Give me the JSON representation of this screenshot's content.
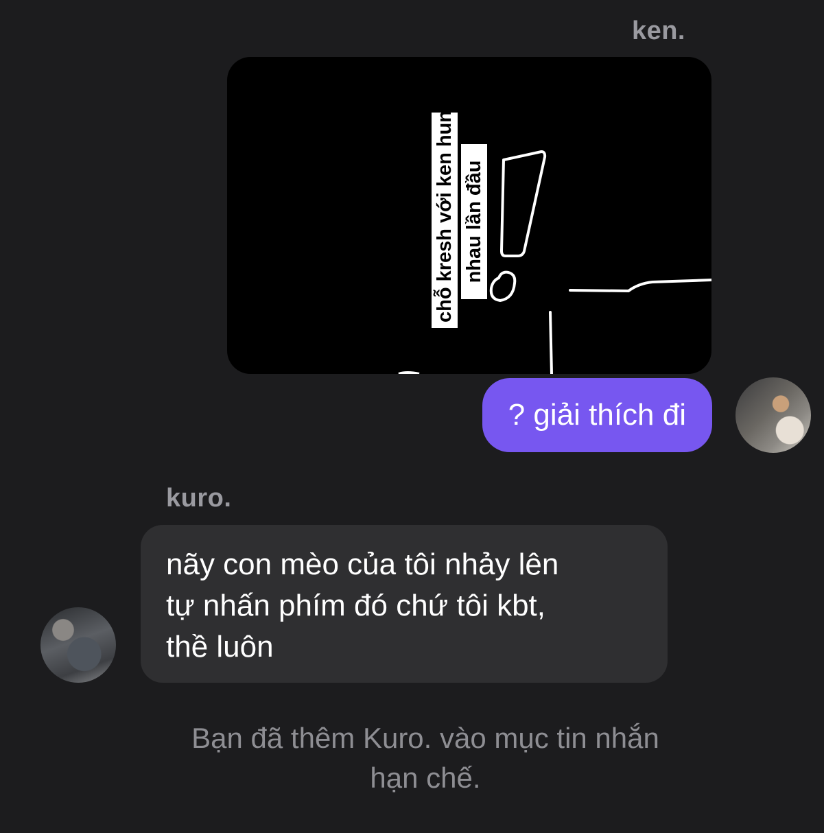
{
  "conversation": {
    "ken": {
      "name": "ken.",
      "image_caption_line1": "chỗ kresh với ken hun",
      "image_caption_line2": "nhau lần đầu",
      "message": "? giải thích đi",
      "bubble_color": "#7757f0"
    },
    "kuro": {
      "name": "kuro.",
      "message_line1": "nãy con mèo của tôi nhảy lên",
      "message_line2": "tự nhấn phím đó chứ tôi kbt,",
      "message_line3": "thề luôn",
      "bubble_color": "#2f2f31"
    },
    "system_notice_line1": "Bạn đã thêm Kuro. vào mục tin nhắn",
    "system_notice_line2": "hạn chế."
  },
  "theme": {
    "background": "#1c1c1e",
    "name_color": "#9a9aa0",
    "notice_color": "#8e8e93"
  }
}
